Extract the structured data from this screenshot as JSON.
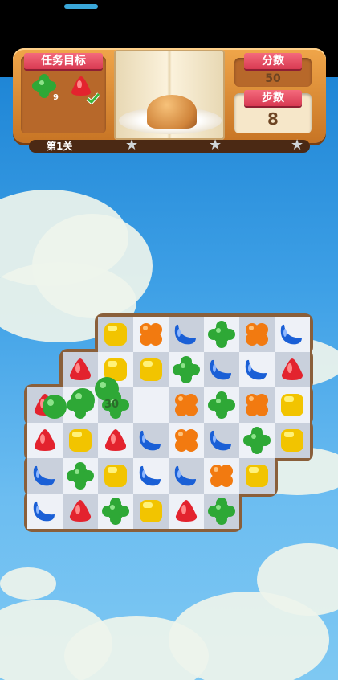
{
  "header": {
    "goal_title": "任务目标",
    "goals": [
      {
        "icon": "green-flower-candy",
        "count": "9"
      },
      {
        "icon": "red-triangle-candy",
        "done": true
      }
    ],
    "score_title": "分数",
    "score_value": "50",
    "moves_title": "步数",
    "moves_value": "8",
    "level_label": "第1关",
    "progress": 0.12,
    "stars": 3
  },
  "board": {
    "score_popup": "30",
    "grid": [
      [
        "",
        "",
        "",
        "yellow",
        "orange",
        "blue",
        "green",
        "orange",
        "blue"
      ],
      [
        "",
        "",
        "red",
        "yellow",
        "yellow",
        "green",
        "blue",
        "blue",
        "red"
      ],
      [
        "",
        "red",
        "green",
        "green",
        "",
        "orange",
        "green",
        "orange",
        "yellow"
      ],
      [
        "",
        "red",
        "yellow",
        "red",
        "blue",
        "orange",
        "blue",
        "green",
        "yellow"
      ],
      [
        "",
        "blue",
        "green",
        "yellow",
        "blue",
        "blue",
        "orange",
        "yellow",
        ""
      ],
      [
        "",
        "blue",
        "red",
        "green",
        "yellow",
        "red",
        "green",
        "",
        ""
      ]
    ]
  },
  "colors": {
    "accent_red": "#d83a52",
    "panel": "#e0913a"
  }
}
